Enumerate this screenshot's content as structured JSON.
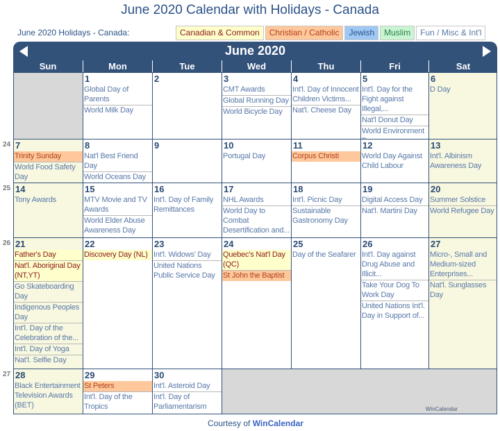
{
  "page_title": "June 2020 Calendar with Holidays - Canada",
  "subtitle": "June 2020 Holidays - Canada:",
  "legend": [
    {
      "label": "Canadian & Common",
      "type": "can"
    },
    {
      "label": "Christian / Catholic",
      "type": "chr"
    },
    {
      "label": "Jewish",
      "type": "jew"
    },
    {
      "label": "Muslim",
      "type": "mus"
    },
    {
      "label": "Fun / Misc & Int'l",
      "type": "fun"
    }
  ],
  "calendar": {
    "month_label": "June 2020",
    "prev_icon": "triangle-left",
    "next_icon": "triangle-right",
    "weekdays": [
      "Sun",
      "Mon",
      "Tue",
      "Wed",
      "Thu",
      "Fri",
      "Sat"
    ],
    "weeks": [
      {
        "week_number": "",
        "days": [
          {
            "day": "",
            "empty": true,
            "events": []
          },
          {
            "day": "1",
            "events": [
              {
                "text": "Global Day of Parents",
                "type": "fun"
              },
              {
                "text": "World Milk Day",
                "type": "fun"
              }
            ]
          },
          {
            "day": "2",
            "events": []
          },
          {
            "day": "3",
            "events": [
              {
                "text": "CMT Awards",
                "type": "fun"
              },
              {
                "text": "Global Running Day",
                "type": "fun"
              },
              {
                "text": "World Bicycle Day",
                "type": "fun"
              }
            ]
          },
          {
            "day": "4",
            "events": [
              {
                "text": "Int'l. Day of Innocent Children Victims...",
                "type": "fun"
              },
              {
                "text": "Nat'l. Cheese Day",
                "type": "fun"
              }
            ]
          },
          {
            "day": "5",
            "events": [
              {
                "text": "Int'l. Day for the Fight against Illegal,...",
                "type": "fun"
              },
              {
                "text": "Nat'l Donut Day",
                "type": "fun"
              },
              {
                "text": "World Environment Day",
                "type": "fun"
              }
            ]
          },
          {
            "day": "6",
            "weekend": true,
            "events": [
              {
                "text": "D Day",
                "type": "fun"
              }
            ]
          }
        ]
      },
      {
        "week_number": "24",
        "days": [
          {
            "day": "7",
            "weekend": true,
            "events": [
              {
                "text": "Trinity Sunday",
                "type": "chr"
              },
              {
                "text": "World Food Safety Day",
                "type": "fun"
              }
            ]
          },
          {
            "day": "8",
            "events": [
              {
                "text": "Nat'l Best Friend Day",
                "type": "fun"
              },
              {
                "text": "World Oceans Day",
                "type": "fun"
              }
            ]
          },
          {
            "day": "9",
            "events": []
          },
          {
            "day": "10",
            "events": [
              {
                "text": "Portugal Day",
                "type": "fun"
              }
            ]
          },
          {
            "day": "11",
            "events": [
              {
                "text": "Corpus Christi",
                "type": "chr"
              }
            ]
          },
          {
            "day": "12",
            "events": [
              {
                "text": "World Day Against Child Labour",
                "type": "fun"
              }
            ]
          },
          {
            "day": "13",
            "weekend": true,
            "events": [
              {
                "text": "Int'l. Albinism Awareness Day",
                "type": "fun"
              }
            ]
          }
        ]
      },
      {
        "week_number": "25",
        "days": [
          {
            "day": "14",
            "weekend": true,
            "events": [
              {
                "text": "Tony Awards",
                "type": "fun"
              }
            ]
          },
          {
            "day": "15",
            "events": [
              {
                "text": "MTV Movie and TV Awards",
                "type": "fun"
              },
              {
                "text": "World Elder Abuse Awareness Day",
                "type": "fun"
              }
            ]
          },
          {
            "day": "16",
            "events": [
              {
                "text": "Int'l. Day of Family Remittances",
                "type": "fun"
              }
            ]
          },
          {
            "day": "17",
            "events": [
              {
                "text": "NHL Awards",
                "type": "fun"
              },
              {
                "text": "World Day to Combat Desertification and...",
                "type": "fun"
              }
            ]
          },
          {
            "day": "18",
            "events": [
              {
                "text": "Int'l. Picnic Day",
                "type": "fun"
              },
              {
                "text": "Sustainable Gastronomy Day",
                "type": "fun"
              }
            ]
          },
          {
            "day": "19",
            "events": [
              {
                "text": "Digital Access Day",
                "type": "fun"
              },
              {
                "text": "Nat'l. Martini Day",
                "type": "fun"
              }
            ]
          },
          {
            "day": "20",
            "weekend": true,
            "events": [
              {
                "text": "Summer Solstice",
                "type": "fun"
              },
              {
                "text": "World Refugee Day",
                "type": "fun"
              }
            ]
          }
        ]
      },
      {
        "week_number": "26",
        "days": [
          {
            "day": "21",
            "weekend": true,
            "events": [
              {
                "text": "Father's Day",
                "type": "can"
              },
              {
                "text": "Nat'l. Aboriginal Day (NT,YT)",
                "type": "can"
              },
              {
                "text": "Go Skateboarding Day",
                "type": "fun"
              },
              {
                "text": "Indigenous Peoples Day",
                "type": "fun"
              },
              {
                "text": "Int'l. Day of the Celebration of the...",
                "type": "fun"
              },
              {
                "text": "Int'l. Day of Yoga",
                "type": "fun"
              },
              {
                "text": "Nat'l. Selfie Day",
                "type": "fun"
              }
            ]
          },
          {
            "day": "22",
            "events": [
              {
                "text": "Discovery Day (NL)",
                "type": "can"
              }
            ]
          },
          {
            "day": "23",
            "events": [
              {
                "text": "Int'l. Widows' Day",
                "type": "fun"
              },
              {
                "text": "United Nations Public Service Day",
                "type": "fun"
              }
            ]
          },
          {
            "day": "24",
            "events": [
              {
                "text": "Quebec's Nat'l Day (QC)",
                "type": "can"
              },
              {
                "text": "St John the Baptist",
                "type": "chr"
              }
            ]
          },
          {
            "day": "25",
            "events": [
              {
                "text": "Day of the Seafarer",
                "type": "fun"
              }
            ]
          },
          {
            "day": "26",
            "events": [
              {
                "text": "Int'l. Day against Drug Abuse and Illicit...",
                "type": "fun"
              },
              {
                "text": "Take Your Dog To Work Day",
                "type": "fun"
              },
              {
                "text": "United Nations Int'l. Day in Support of...",
                "type": "fun"
              }
            ]
          },
          {
            "day": "27",
            "weekend": true,
            "events": [
              {
                "text": "Micro-, Small and Medium-sized Enterprises...",
                "type": "fun"
              },
              {
                "text": "Nat'l. Sunglasses Day",
                "type": "fun"
              }
            ]
          }
        ]
      },
      {
        "week_number": "27",
        "days": [
          {
            "day": "28",
            "weekend": true,
            "events": [
              {
                "text": "Black Entertainment Television Awards (BET)",
                "type": "fun"
              }
            ]
          },
          {
            "day": "29",
            "events": [
              {
                "text": "St Peters",
                "type": "chr"
              },
              {
                "text": "Int'l. Day of the Tropics",
                "type": "fun"
              }
            ]
          },
          {
            "day": "30",
            "events": [
              {
                "text": "Int'l. Asteroid Day",
                "type": "fun"
              },
              {
                "text": "Int'l. Day of Parliamentarism",
                "type": "fun"
              }
            ]
          }
        ]
      }
    ],
    "watermark": "WinCalendar"
  },
  "footer": {
    "courtesy_text": "Courtesy of ",
    "link_text": "WinCalendar"
  }
}
